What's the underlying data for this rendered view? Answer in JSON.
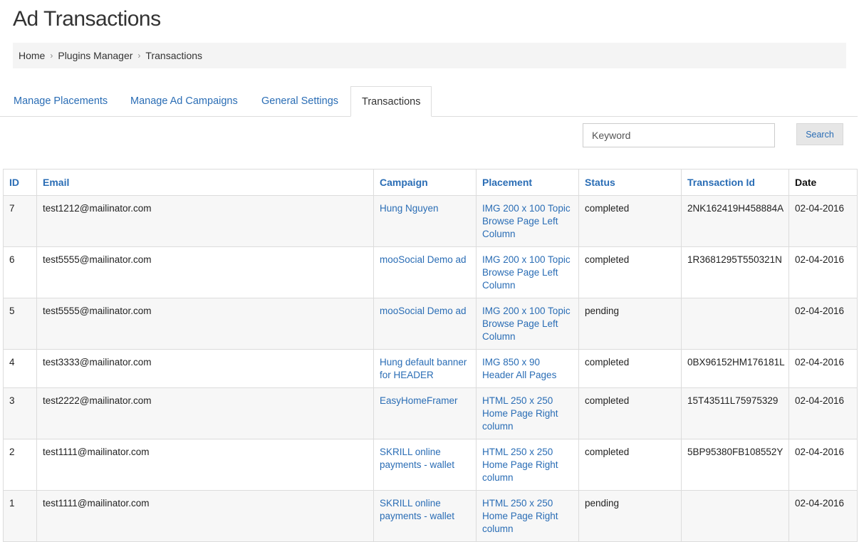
{
  "page": {
    "title": "Ad Transactions"
  },
  "breadcrumb": {
    "items": [
      "Home",
      "Plugins Manager",
      "Transactions"
    ]
  },
  "tabs": [
    {
      "label": "Manage Placements"
    },
    {
      "label": "Manage Ad Campaigns"
    },
    {
      "label": "General Settings"
    },
    {
      "label": "Transactions"
    }
  ],
  "search": {
    "placeholder": "Keyword",
    "button_label": "Search"
  },
  "table": {
    "columns": [
      "ID",
      "Email",
      "Campaign",
      "Placement",
      "Status",
      "Transaction Id",
      "Date"
    ],
    "rows": [
      {
        "id": "7",
        "email": "test1212@mailinator.com",
        "campaign": "Hung Nguyen",
        "placement": "IMG 200 x 100 Topic Browse Page Left Column",
        "status": "completed",
        "transaction_id": "2NK162419H458884A",
        "date": "02-04-2016"
      },
      {
        "id": "6",
        "email": "test5555@mailinator.com",
        "campaign": "mooSocial Demo ad",
        "placement": "IMG 200 x 100 Topic Browse Page Left Column",
        "status": "completed",
        "transaction_id": "1R3681295T550321N",
        "date": "02-04-2016"
      },
      {
        "id": "5",
        "email": "test5555@mailinator.com",
        "campaign": "mooSocial Demo ad",
        "placement": "IMG 200 x 100 Topic Browse Page Left Column",
        "status": "pending",
        "transaction_id": "",
        "date": "02-04-2016"
      },
      {
        "id": "4",
        "email": "test3333@mailinator.com",
        "campaign": "Hung default banner for HEADER",
        "placement": "IMG 850 x 90 Header All Pages",
        "status": "completed",
        "transaction_id": "0BX96152HM176181L",
        "date": "02-04-2016"
      },
      {
        "id": "3",
        "email": "test2222@mailinator.com",
        "campaign": "EasyHomeFramer",
        "placement": "HTML 250 x 250 Home Page Right column",
        "status": "completed",
        "transaction_id": "15T43511L75975329",
        "date": "02-04-2016"
      },
      {
        "id": "2",
        "email": "test1111@mailinator.com",
        "campaign": "SKRILL online payments - wallet",
        "placement": "HTML 250 x 250 Home Page Right column",
        "status": "completed",
        "transaction_id": "5BP95380FB108552Y",
        "date": "02-04-2016"
      },
      {
        "id": "1",
        "email": "test1111@mailinator.com",
        "campaign": "SKRILL online payments - wallet",
        "placement": "HTML 250 x 250 Home Page Right column",
        "status": "pending",
        "transaction_id": "",
        "date": "02-04-2016"
      }
    ]
  }
}
